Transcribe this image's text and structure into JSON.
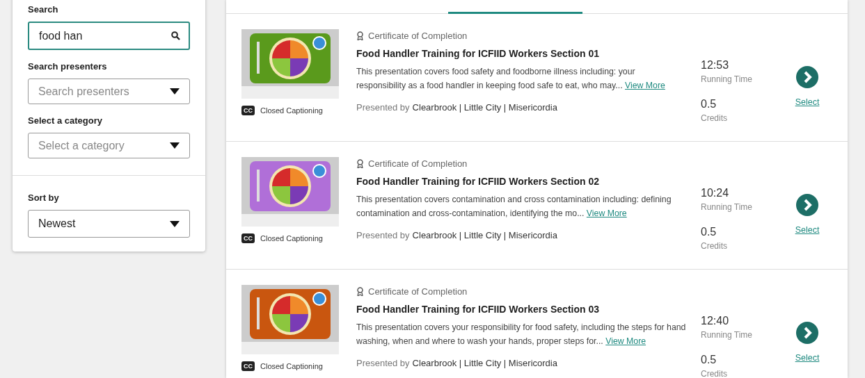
{
  "filters": {
    "search": {
      "label": "Search",
      "value": "food han"
    },
    "presenters": {
      "label": "Search presenters",
      "placeholder": "Search presenters"
    },
    "category": {
      "label": "Select a category",
      "placeholder": "Select a category"
    },
    "sort": {
      "label": "Sort by",
      "value": "Newest"
    }
  },
  "courses": [
    {
      "color": "#5a9a1c",
      "certificate": "Certificate of Completion",
      "title": "Food Handler Training for ICFIID Workers Section 01",
      "description": "This presentation covers food safety and foodborne illness including: your responsibility as a food handler in keeping food safe to eat, who may...",
      "link": "View More",
      "presented_prefix": "Presented by",
      "presenters": "Clearbrook | Little City | Misericordia",
      "caption_badge": "CC",
      "captioning": "Closed Captioning",
      "running_time": "12:53",
      "running_time_label": "Running Time",
      "credits": "0.5",
      "credits_label": "Credits",
      "action": "Select"
    },
    {
      "color": "#b06fd8",
      "certificate": "Certificate of Completion",
      "title": "Food Handler Training for ICFIID Workers Section 02",
      "description": "This presentation covers contamination and cross contamination including: defining contamination and cross-contamination, identifying the mo...",
      "link": "View More",
      "presented_prefix": "Presented by",
      "presenters": "Clearbrook | Little City | Misericordia",
      "caption_badge": "CC",
      "captioning": "Closed Captioning",
      "running_time": "10:24",
      "running_time_label": "Running Time",
      "credits": "0.5",
      "credits_label": "Credits",
      "action": "Select"
    },
    {
      "color": "#c9560f",
      "certificate": "Certificate of Completion",
      "title": "Food Handler Training for ICFIID Workers Section 03",
      "description": "This presentation covers your responsibility for food safety, including the steps for hand washing, when and where to wash your hands, proper steps for...",
      "link": "View More",
      "presented_prefix": "Presented by",
      "presenters": "Clearbrook | Little City | Misericordia",
      "caption_badge": "CC",
      "captioning": "Closed Captioning",
      "running_time": "12:40",
      "running_time_label": "Running Time",
      "credits": "0.5",
      "credits_label": "Credits",
      "action": "Select"
    }
  ]
}
